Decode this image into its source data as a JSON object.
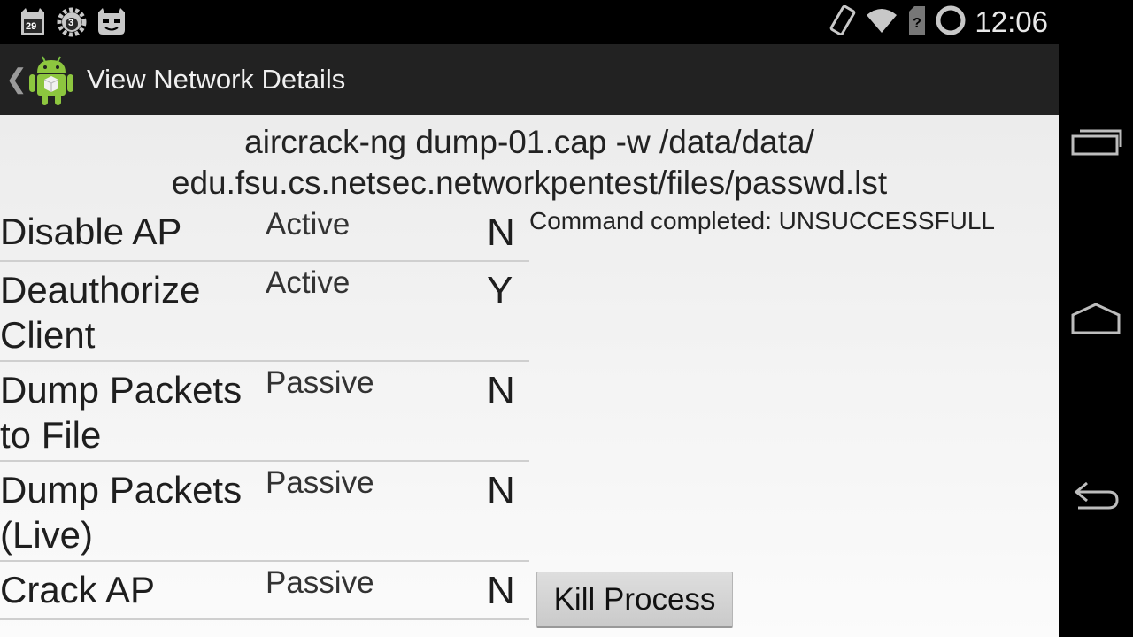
{
  "statusbar": {
    "badge_a": "29",
    "badge_b": "3",
    "time": "12:06",
    "icons": [
      "calendar-cat-icon",
      "settings-gear-icon",
      "cyanogen-mascot-icon",
      "screen-rotation-icon",
      "wifi-icon",
      "no-sim-icon",
      "battery-charging-icon"
    ]
  },
  "actionbar": {
    "title": "View Network Details",
    "up_glyph": "❮"
  },
  "command": {
    "line1": "aircrack-ng dump-01.cap -w /data/data/",
    "line2": "edu.fsu.cs.netsec.networkpentest/files/passwd.lst"
  },
  "rows": [
    {
      "name": "Disable AP",
      "type": "Active",
      "flag": "N"
    },
    {
      "name": "Deauthorize Client",
      "type": "Active",
      "flag": "Y"
    },
    {
      "name": "Dump Packets to File",
      "type": "Passive",
      "flag": "N"
    },
    {
      "name": "Dump Packets (Live)",
      "type": "Passive",
      "flag": "N"
    },
    {
      "name": "Crack AP",
      "type": "Passive",
      "flag": "N"
    }
  ],
  "status_message": "Command completed: UNSUCCESSFULL",
  "kill_button_label": "Kill Process",
  "colors": {
    "actionbar": "#222222",
    "content_bg": "#f2f2f2",
    "divider": "#cfcfcf"
  }
}
